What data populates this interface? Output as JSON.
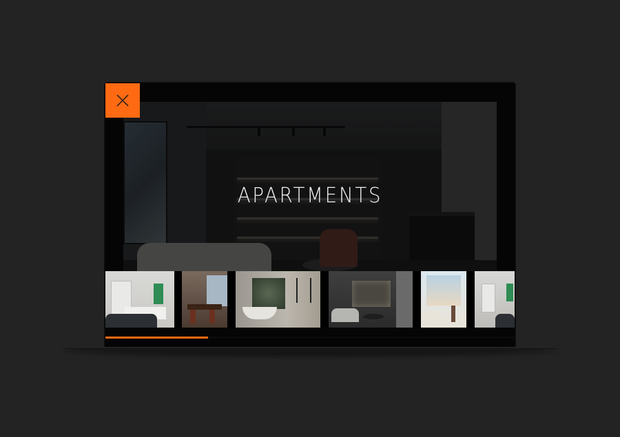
{
  "page": {
    "background": "#232323"
  },
  "hero": {
    "title": "APARTMENTS"
  },
  "close_button": {
    "icon": "close-icon",
    "color": "#ff6a13"
  },
  "gallery": {
    "thumbnails": [
      {
        "name": "bedroom-thumbnail"
      },
      {
        "name": "dining-room-thumbnail"
      },
      {
        "name": "bathroom-thumbnail"
      },
      {
        "name": "living-room-thumbnail"
      },
      {
        "name": "window-lounge-thumbnail"
      },
      {
        "name": "bedroom-2-thumbnail"
      }
    ]
  },
  "progress": {
    "value": 0.25,
    "color": "#ff6a13"
  }
}
